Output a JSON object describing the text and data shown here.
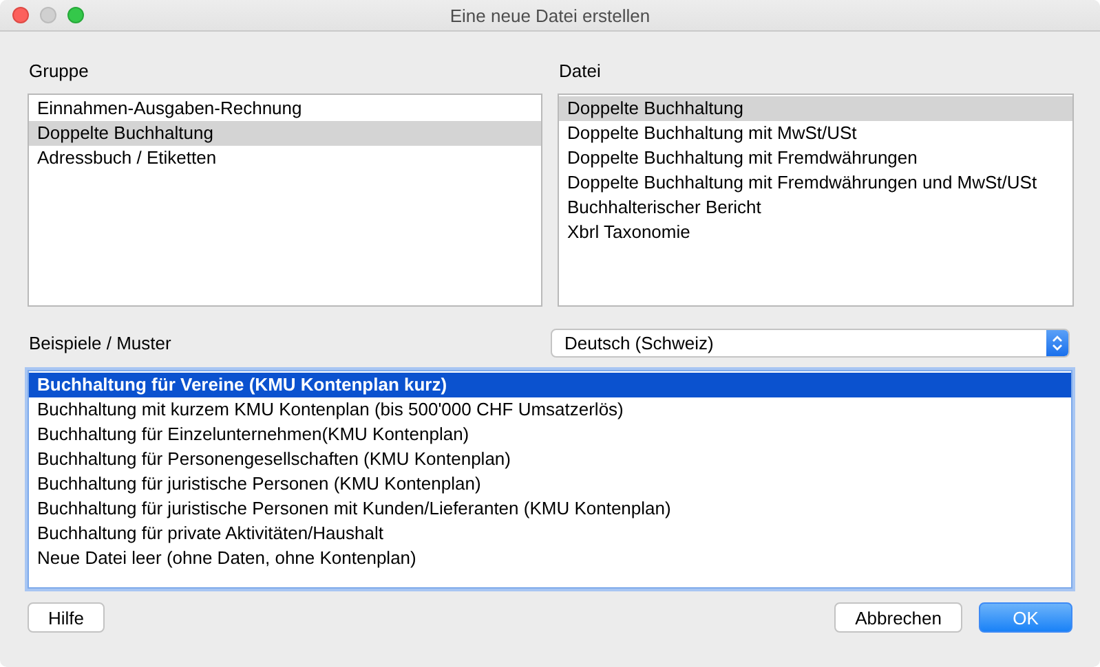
{
  "window": {
    "title": "Eine neue Datei erstellen"
  },
  "group": {
    "label": "Gruppe",
    "items": [
      {
        "text": "Einnahmen-Ausgaben-Rechnung",
        "selected": false
      },
      {
        "text": "Doppelte Buchhaltung",
        "selected": true
      },
      {
        "text": "Adressbuch / Etiketten",
        "selected": false
      }
    ]
  },
  "file": {
    "label": "Datei",
    "items": [
      {
        "text": "Doppelte Buchhaltung",
        "selected": true
      },
      {
        "text": "Doppelte Buchhaltung mit MwSt/USt",
        "selected": false
      },
      {
        "text": "Doppelte Buchhaltung mit Fremdwährungen",
        "selected": false
      },
      {
        "text": "Doppelte Buchhaltung mit Fremdwährungen und MwSt/USt",
        "selected": false
      },
      {
        "text": "Buchhalterischer Bericht",
        "selected": false
      },
      {
        "text": "Xbrl Taxonomie",
        "selected": false
      }
    ]
  },
  "examples": {
    "label": "Beispiele / Muster",
    "language": "Deutsch (Schweiz)",
    "focused": true,
    "items": [
      {
        "text": "Buchhaltung für Vereine (KMU Kontenplan kurz)",
        "selected": true
      },
      {
        "text": "Buchhaltung mit kurzem KMU Kontenplan (bis 500'000 CHF Umsatzerlös)",
        "selected": false
      },
      {
        "text": "Buchhaltung für Einzelunternehmen(KMU Kontenplan)",
        "selected": false
      },
      {
        "text": "Buchhaltung für Personengesellschaften (KMU Kontenplan)",
        "selected": false
      },
      {
        "text": "Buchhaltung für juristische Personen (KMU Kontenplan)",
        "selected": false
      },
      {
        "text": "Buchhaltung für juristische Personen mit Kunden/Lieferanten (KMU Kontenplan)",
        "selected": false
      },
      {
        "text": "Buchhaltung für private Aktivitäten/Haushalt",
        "selected": false
      },
      {
        "text": "Neue Datei leer (ohne Daten, ohne Kontenplan)",
        "selected": false
      }
    ]
  },
  "buttons": [
    {
      "text": "Hilfe",
      "kind": "plain"
    },
    {
      "text": "Abbrechen",
      "kind": "plain"
    },
    {
      "text": "OK",
      "kind": "default"
    }
  ]
}
